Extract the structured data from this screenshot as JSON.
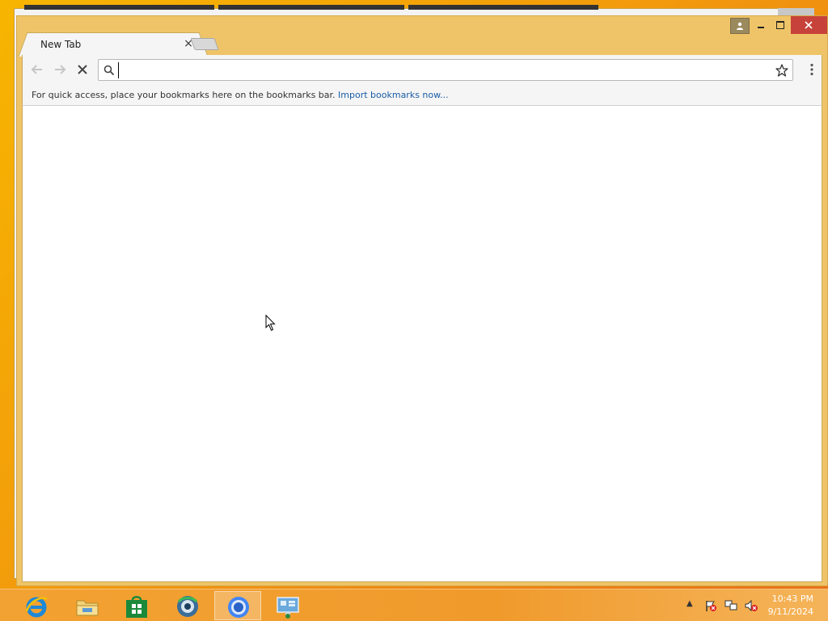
{
  "browser": {
    "tab": {
      "title": "New Tab",
      "close_symbol": "×"
    },
    "omnibox": {
      "value": "",
      "placeholder": ""
    },
    "bookmarks_bar": {
      "message": "For quick access, place your bookmarks here on the bookmarks bar.",
      "import_link": "Import bookmarks now..."
    },
    "state": "loading"
  },
  "taskbar": {
    "apps": [
      {
        "name": "Internet Explorer",
        "icon": "ie-icon"
      },
      {
        "name": "File Explorer",
        "icon": "folder-icon"
      },
      {
        "name": "Store",
        "icon": "store-icon"
      },
      {
        "name": "App",
        "icon": "globe-app-icon"
      },
      {
        "name": "Chrome",
        "icon": "chrome-icon",
        "active": true
      },
      {
        "name": "Remote Desktop",
        "icon": "remote-desktop-icon"
      }
    ],
    "clock": {
      "time": "10:43 PM",
      "date": "9/11/2024"
    }
  },
  "colors": {
    "desktop": "#f29a0c",
    "chrome_frame": "#efc468",
    "close_button": "#c7423a",
    "link": "#1a5ca5"
  }
}
